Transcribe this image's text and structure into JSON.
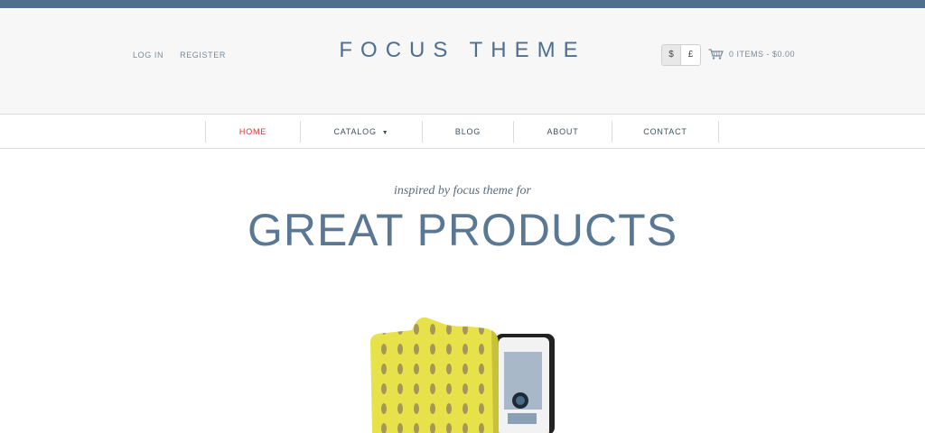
{
  "header": {
    "account_links": [
      "LOG IN",
      "REGISTER"
    ],
    "logo": "FOCUS THEME",
    "currencies": [
      "$",
      "£"
    ],
    "selected_currency": "$",
    "cart_label": "0 ITEMS - $0.00"
  },
  "nav": {
    "items": [
      "HOME",
      "CATALOG",
      "BLOG",
      "ABOUT",
      "CONTACT"
    ],
    "active": "HOME"
  },
  "hero": {
    "tagline": "inspired by focus theme for",
    "title": "GREAT PRODUCTS"
  },
  "colors": {
    "brand": "#4e6f8e",
    "nav_active": "#d2363a",
    "product_case": "#e7e24a"
  },
  "icons": [
    "cart-icon",
    "chevron-down-icon"
  ]
}
